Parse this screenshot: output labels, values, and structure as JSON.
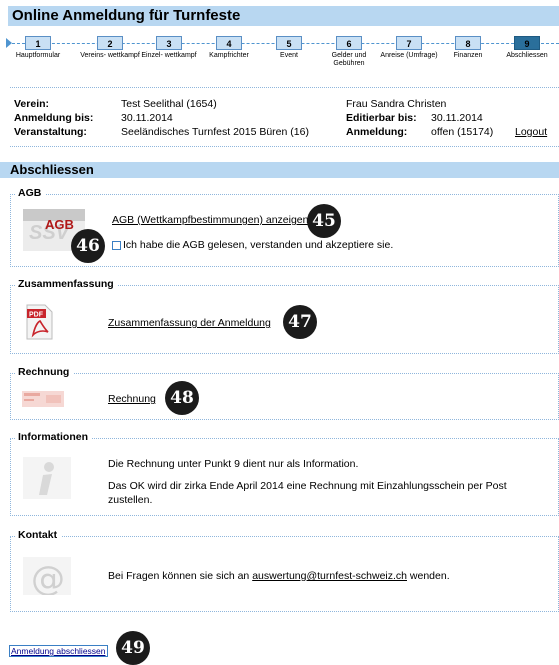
{
  "page": {
    "title": "Online Anmeldung für Turnfeste",
    "section_title": "Abschliessen"
  },
  "steps": [
    {
      "num": "1",
      "label": "Hauptformular",
      "active": false
    },
    {
      "num": "2",
      "label": "Vereins- wettkampf",
      "active": false
    },
    {
      "num": "3",
      "label": "Einzel- wettkampf",
      "active": false
    },
    {
      "num": "4",
      "label": "Kampfrichter",
      "active": false
    },
    {
      "num": "5",
      "label": "Event",
      "active": false
    },
    {
      "num": "6",
      "label": "Gelder und Gebühren",
      "active": false
    },
    {
      "num": "7",
      "label": "Anreise (Umfrage)",
      "active": false
    },
    {
      "num": "8",
      "label": "Finanzen",
      "active": false
    },
    {
      "num": "9",
      "label": "Abschliessen",
      "active": true
    }
  ],
  "info": {
    "verein_label": "Verein:",
    "verein_value": "Test Seelithal (1654)",
    "anmeldung_bis_label": "Anmeldung bis:",
    "anmeldung_bis_value": "30.11.2014",
    "veranstaltung_label": "Veranstaltung:",
    "veranstaltung_value": "Seeländisches Turnfest 2015 Büren (16)",
    "contact_name": "Frau Sandra Christen",
    "editierbar_label": "Editierbar bis:",
    "editierbar_value": "30.11.2014",
    "anmeldung_label": "Anmeldung:",
    "anmeldung_value": "offen (15174)",
    "logout": "Logout"
  },
  "agb": {
    "legend": "AGB",
    "icon_text": "AGB",
    "link": "AGB (Wettkampfbestimmungen) anzeigen",
    "checkbox_label": "Ich habe die AGB gelesen, verstanden und akzeptiere sie."
  },
  "zusammenfassung": {
    "legend": "Zusammenfassung",
    "icon_text": "PDF",
    "link": "Zusammenfassung der Anmeldung"
  },
  "rechnung": {
    "legend": "Rechnung",
    "link": "Rechnung"
  },
  "informationen": {
    "legend": "Informationen",
    "line1": "Die Rechnung unter Punkt 9 dient nur als Information.",
    "line2": "Das OK wird dir zirka Ende April 2014 eine Rechnung mit Einzahlungsschein per Post",
    "line3": "zustellen."
  },
  "kontakt": {
    "legend": "Kontakt",
    "text_before": "Bei Fragen können sie sich an",
    "email": "auswertung@turnfest-schweiz.ch",
    "text_after": "wenden."
  },
  "footer": {
    "button_label": "Anmeldung abschliessen"
  },
  "callouts": [
    "45",
    "46",
    "47",
    "48",
    "49"
  ],
  "colors": {
    "header_bg": "#b8d7f1",
    "accent": "#3a7fc4",
    "active_step": "#2a6f9b"
  }
}
